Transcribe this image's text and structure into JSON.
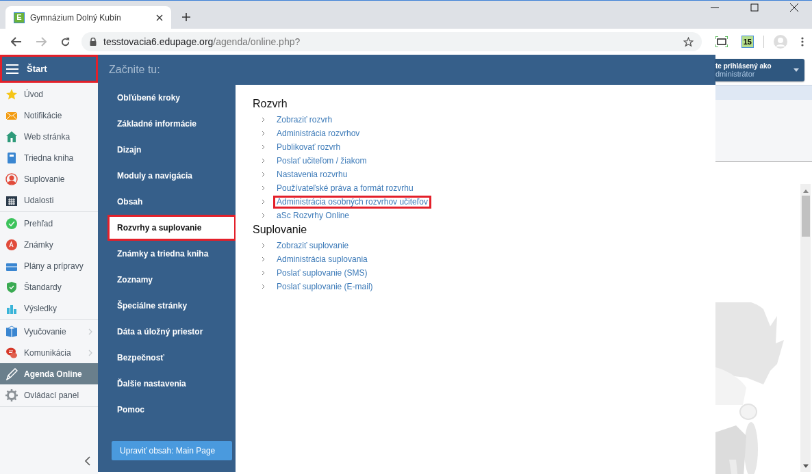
{
  "browser": {
    "tab": {
      "favicon_letter": "E",
      "title": "Gymnázium Dolný Kubín"
    },
    "url": {
      "host": "tesstovacia6.edupage.org",
      "path": "/agenda/online.php?"
    },
    "extension_badge": "15"
  },
  "sidebar": {
    "header": {
      "label": "Štart",
      "highlighted": true
    },
    "groups": [
      [
        {
          "label": "Úvod",
          "selected": false,
          "has_submenu": false
        },
        {
          "label": "Notifikácie",
          "selected": false,
          "has_submenu": false
        },
        {
          "label": "Web stránka",
          "selected": false,
          "has_submenu": false
        },
        {
          "label": "Triedna kniha",
          "selected": false,
          "has_submenu": false
        },
        {
          "label": "Suplovanie",
          "selected": false,
          "has_submenu": false
        },
        {
          "label": "Udalosti",
          "selected": false,
          "has_submenu": false
        }
      ],
      [
        {
          "label": "Prehľad",
          "selected": false,
          "has_submenu": false
        },
        {
          "label": "Známky",
          "selected": false,
          "has_submenu": false
        },
        {
          "label": "Plány a prípravy",
          "selected": false,
          "has_submenu": false
        },
        {
          "label": "Štandardy",
          "selected": false,
          "has_submenu": false
        },
        {
          "label": "Výsledky",
          "selected": false,
          "has_submenu": false
        }
      ],
      [
        {
          "label": "Vyučovanie",
          "selected": false,
          "has_submenu": true
        },
        {
          "label": "Komunikácia",
          "selected": false,
          "has_submenu": true
        },
        {
          "label": "Agenda Online",
          "selected": true,
          "has_submenu": false
        },
        {
          "label": "Ovládací panel",
          "selected": false,
          "has_submenu": false
        }
      ]
    ]
  },
  "start_panel": {
    "title": "Začnite tu:",
    "menu": [
      {
        "label": "Obľúbené kroky",
        "selected": false,
        "highlighted": false
      },
      {
        "label": "Základné informácie",
        "selected": false,
        "highlighted": false
      },
      {
        "label": "Dizajn",
        "selected": false,
        "highlighted": false
      },
      {
        "label": "Moduly a navigácia",
        "selected": false,
        "highlighted": false
      },
      {
        "label": "Obsah",
        "selected": false,
        "highlighted": false
      },
      {
        "label": "Rozvrhy a suplovanie",
        "selected": true,
        "highlighted": true
      },
      {
        "label": "Známky a triedna kniha",
        "selected": false,
        "highlighted": false
      },
      {
        "label": "Zoznamy",
        "selected": false,
        "highlighted": false
      },
      {
        "label": "Špeciálne stránky",
        "selected": false,
        "highlighted": false
      },
      {
        "label": "Dáta a úložný priestor",
        "selected": false,
        "highlighted": false
      },
      {
        "label": "Bezpečnosť",
        "selected": false,
        "highlighted": false
      },
      {
        "label": "Ďalšie nastavenia",
        "selected": false,
        "highlighted": false
      },
      {
        "label": "Pomoc",
        "selected": false,
        "highlighted": false
      }
    ],
    "edit_button": "Upraviť obsah: Main Page",
    "sections": [
      {
        "heading": "Rozvrh",
        "links": [
          {
            "label": "Zobraziť rozvrh",
            "highlighted": false
          },
          {
            "label": "Administrácia rozvrhov",
            "highlighted": false
          },
          {
            "label": "Publikovať rozvrh",
            "highlighted": false
          },
          {
            "label": "Poslať učiteľom / žiakom",
            "highlighted": false
          },
          {
            "label": "Nastavenia rozvrhu",
            "highlighted": false
          },
          {
            "label": "Používateľské práva a formát rozvrhu",
            "highlighted": false
          },
          {
            "label": "Administrácia osobných rozvrhov učiteľov",
            "highlighted": true
          },
          {
            "label": "aSc Rozvrhy Online",
            "highlighted": false
          }
        ]
      },
      {
        "heading": "Suplovanie",
        "links": [
          {
            "label": "Zobraziť suplovanie",
            "highlighted": false
          },
          {
            "label": "Administrácia suplovania",
            "highlighted": false
          },
          {
            "label": "Poslať suplovanie (SMS)",
            "highlighted": false
          },
          {
            "label": "Poslať suplovanie (E-mail)",
            "highlighted": false
          }
        ]
      }
    ]
  },
  "user_box": {
    "label": "te prihlásený ako",
    "role": "dministrátor"
  }
}
